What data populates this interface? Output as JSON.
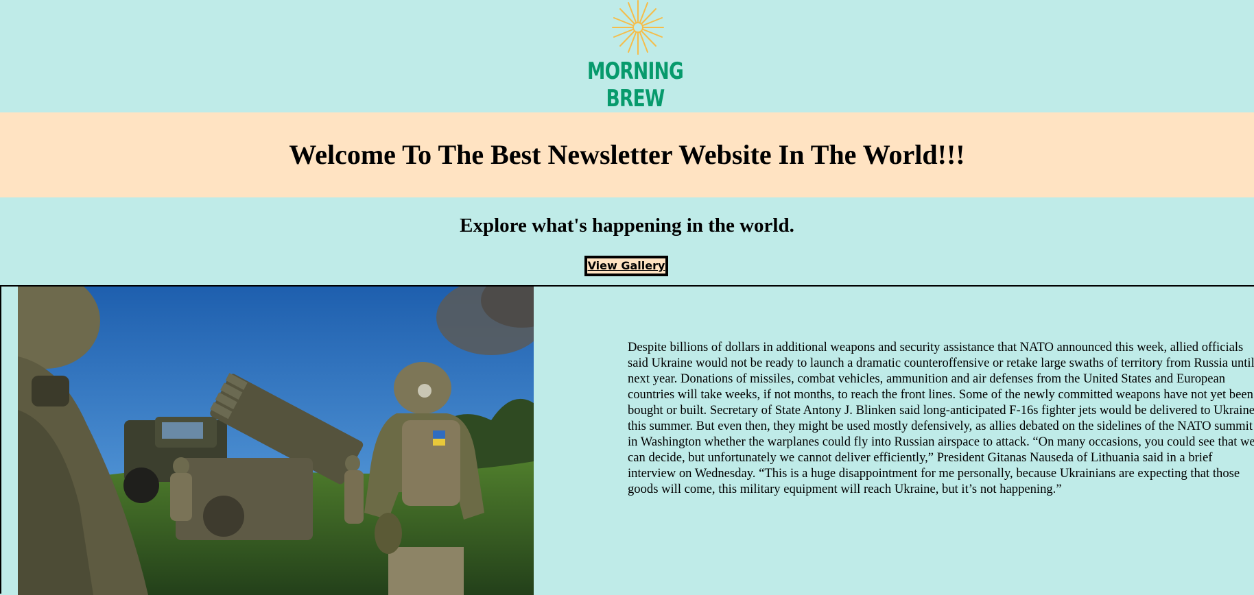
{
  "header": {
    "brand": "MORNING BREW",
    "logo_icon": "sun-icon",
    "brand_color": "#079a6c",
    "sun_color": "#f5bd4a"
  },
  "banner": {
    "title": "Welcome To The Best Newsletter Website In The World!!!",
    "background": "#ffe3c2"
  },
  "intro": {
    "subtitle": "Explore what's happening in the world.",
    "button_label": "View Gallery"
  },
  "article": {
    "image_icon": "soldiers-rocket-launcher-photo",
    "body": "Despite billions of dollars in additional weapons and security assistance that NATO announced this week, allied officials said Ukraine would not be ready to launch a dramatic counteroffensive or retake large swaths of territory from Russia until next year. Donations of missiles, combat vehicles, ammunition and air defenses from the United States and European countries will take weeks, if not months, to reach the front lines. Some of the newly committed weapons have not yet been bought or built. Secretary of State Antony J. Blinken said long-anticipated F-16s fighter jets would be delivered to Ukraine this summer. But even then, they might be used mostly defensively, as allies debated on the sidelines of the NATO summit in Washington whether the warplanes could fly into Russian airspace to attack. “On many occasions, you could see that we can decide, but unfortunately we cannot deliver efficiently,” President Gitanas Nauseda of Lithuania said in a brief interview on Wednesday. “This is a huge disappointment for me personally, because Ukrainians are expecting that those goods will come, this military equipment will reach Ukraine, but it’s not happening.”"
  },
  "colors": {
    "page_background": "#bfebe8"
  }
}
